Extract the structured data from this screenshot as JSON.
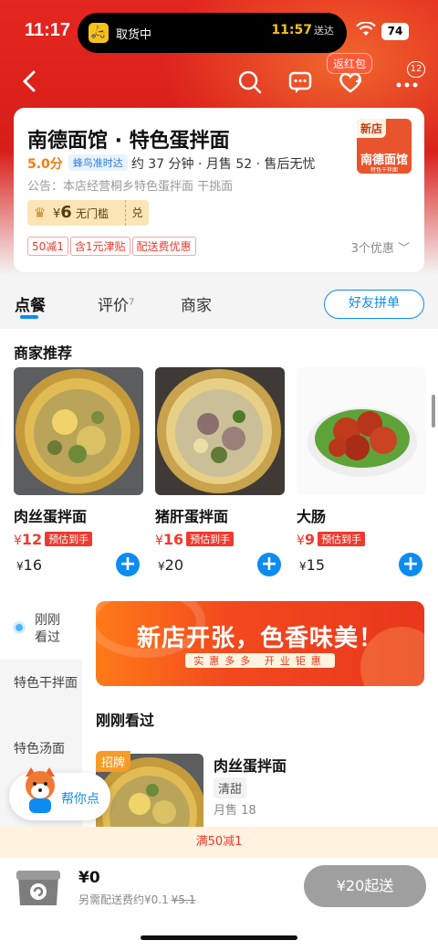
{
  "status_bar": {
    "time": "11:17",
    "pickup_label": "取货中",
    "eta_time": "11:57",
    "eta_suffix": "送达",
    "battery": "74"
  },
  "nav": {
    "redpacket_tip": "返红包",
    "cart_badge": "12"
  },
  "store": {
    "name": "南德面馆 · 特色蛋拌面",
    "score": "5.0分",
    "delivery_badge": "蜂鸟准时达",
    "meta": "约 37 分钟 · 月售 52 · 售后无忧",
    "notice": "公告：本店经营桐乡特色蛋拌面 干挑面",
    "logo_tag": "新店",
    "logo_name": "南德面馆",
    "logo_sub": "特色干拌面",
    "coupon_amount": "6",
    "coupon_currency": "¥",
    "coupon_desc": "无门槛",
    "coupon_redeem": "兑",
    "promos": [
      "50减1",
      "含1元津贴",
      "配送费优惠"
    ],
    "promo_count": "3个优惠"
  },
  "tabs": [
    {
      "label": "点餐"
    },
    {
      "label": "评价",
      "count": "7"
    },
    {
      "label": "商家"
    }
  ],
  "group_button": "好友拼单",
  "recommend": {
    "title": "商家推荐",
    "items": [
      {
        "name": "肉丝蛋拌面",
        "price": "12",
        "tag": "预估到手",
        "orig": "16"
      },
      {
        "name": "猪肝蛋拌面",
        "price": "16",
        "tag": "预估到手",
        "orig": "20"
      },
      {
        "name": "大肠",
        "price": "9",
        "tag": "预估到手",
        "orig": "15"
      }
    ],
    "currency": "¥"
  },
  "sidebar": [
    {
      "label": "刚刚看过"
    },
    {
      "label": "特色干拌面"
    },
    {
      "label": "特色汤面"
    }
  ],
  "banner": {
    "title": "新店开张，色香味美！",
    "sub": "实惠多多 开业钜惠"
  },
  "recent": {
    "title": "刚刚看过",
    "tag": "招牌",
    "name": "肉丝蛋拌面",
    "flavor": "清甜",
    "sales": "月售 18"
  },
  "helper_label": "帮你点",
  "promo_strip": "满50减1",
  "footer": {
    "total": "¥0",
    "fee_text": "另需配送费约¥0.1",
    "fee_original": "¥5.1",
    "checkout": "¥20起送"
  },
  "colors": {
    "brand_red": "#e3261f",
    "accent_blue": "#0d8cf0",
    "price_red": "#ee3a2f"
  }
}
